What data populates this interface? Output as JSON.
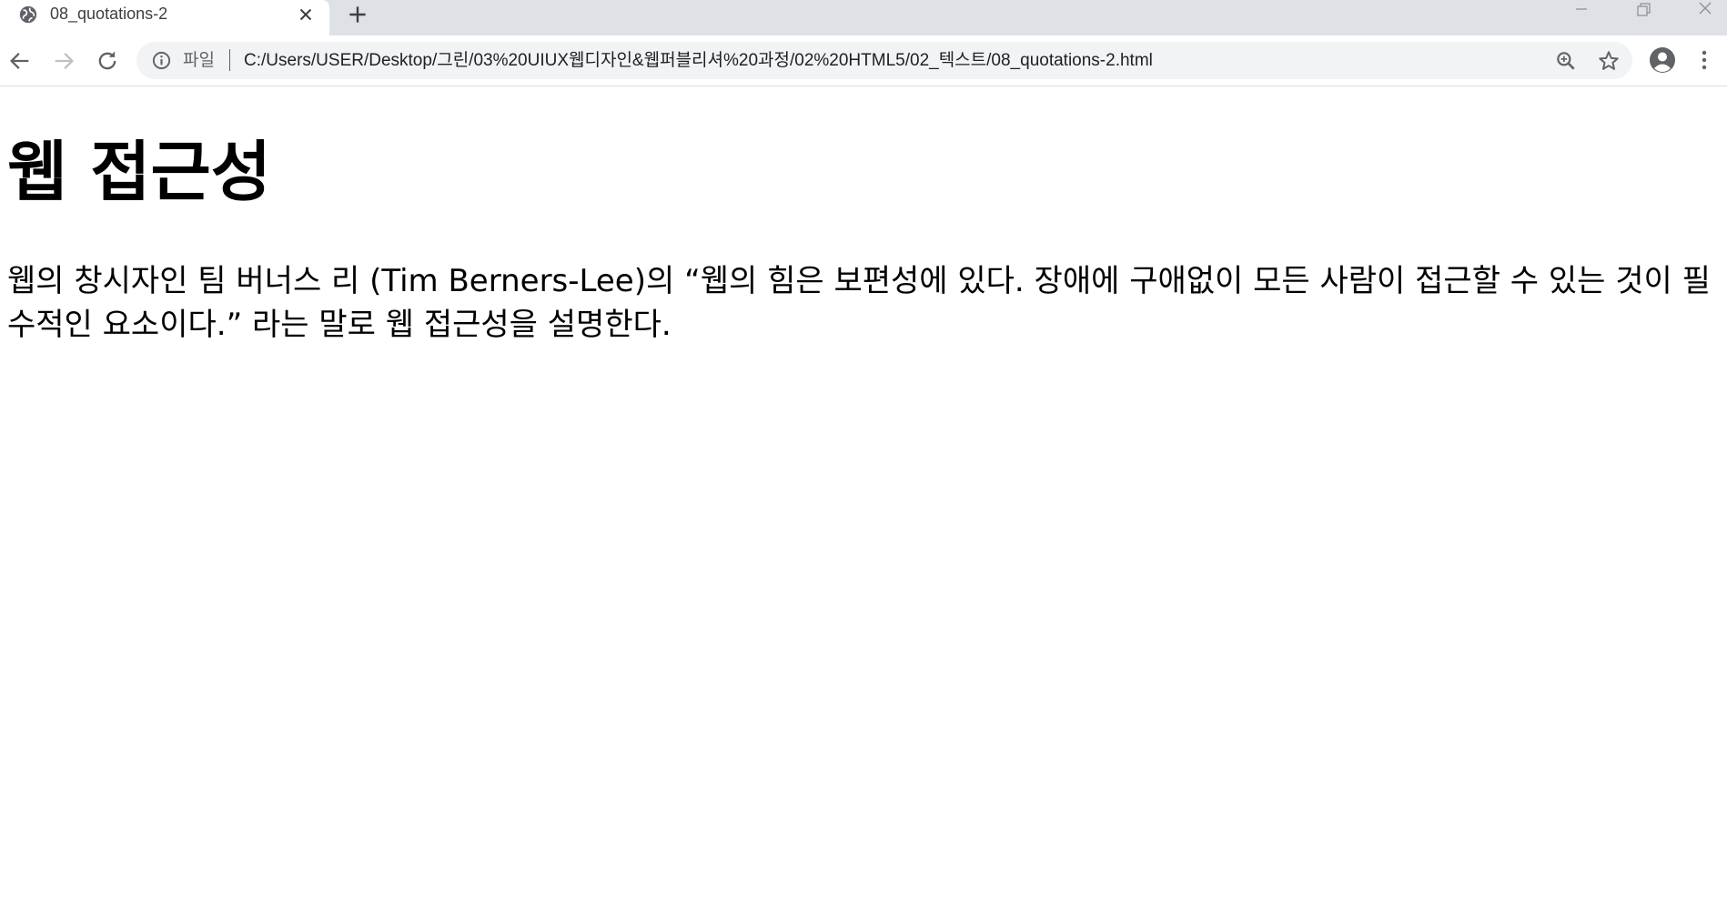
{
  "tab": {
    "title": "08_quotations-2",
    "favicon": "globe-icon"
  },
  "toolbar": {
    "scheme_label": "파일",
    "url": "C:/Users/USER/Desktop/그린/03%20UIUX웹디자인&웹퍼블리셔%20과정/02%20HTML5/02_텍스트/08_quotations-2.html"
  },
  "page": {
    "heading": "웹 접근성",
    "paragraph_before": "웹의 창시자인 팀 버너스 리 (Tim Berners-Lee)의 ",
    "quote": "웹의 힘은 보편성에 있다. 장애에 구애없이 모든 사람이 접근할 수 있는 것이 필수적인 요소이다.",
    "paragraph_after": " 라는 말로 웹 접근성을 설명한다."
  },
  "colors": {
    "tabstrip_bg": "#dee1e6",
    "omnibox_bg": "#f1f3f4",
    "icon_color": "#5f6368"
  }
}
